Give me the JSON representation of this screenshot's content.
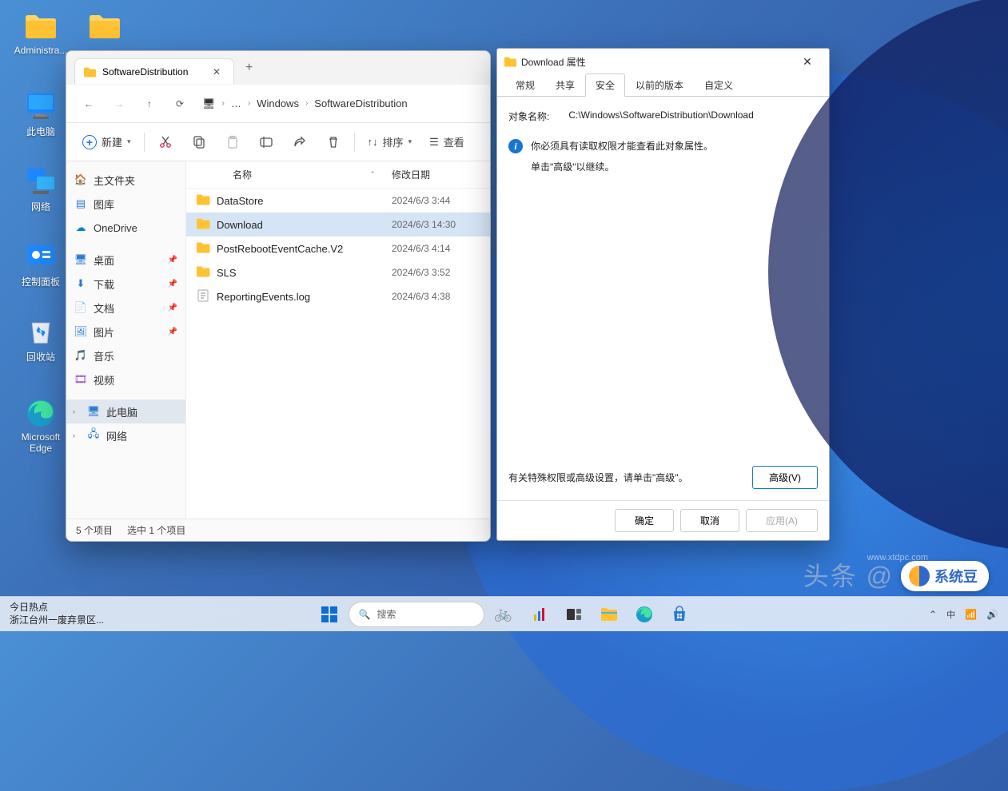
{
  "desktop_icons": {
    "administrator": "Administra...",
    "this_pc": "此电脑",
    "network": "网络",
    "control_panel": "控制面板",
    "recycle_bin": "回收站",
    "edge": "Microsoft Edge"
  },
  "explorer": {
    "tab_title": "SoftwareDistribution",
    "breadcrumb": {
      "ellipsis": "…",
      "seg1": "Windows",
      "seg2": "SoftwareDistribution"
    },
    "toolbar": {
      "new": "新建",
      "sort": "排序",
      "view": "查看"
    },
    "sidebar": {
      "home": "主文件夹",
      "gallery": "图库",
      "onedrive": "OneDrive",
      "desktop": "桌面",
      "downloads": "下载",
      "documents": "文档",
      "pictures": "图片",
      "music": "音乐",
      "videos": "视频",
      "this_pc": "此电脑",
      "network": "网络"
    },
    "columns": {
      "name": "名称",
      "modified": "修改日期"
    },
    "files": [
      {
        "name": "DataStore",
        "type": "folder",
        "date": "2024/6/3 3:44"
      },
      {
        "name": "Download",
        "type": "folder",
        "date": "2024/6/3 14:30",
        "selected": true
      },
      {
        "name": "PostRebootEventCache.V2",
        "type": "folder",
        "date": "2024/6/3 4:14"
      },
      {
        "name": "SLS",
        "type": "folder",
        "date": "2024/6/3 3:52"
      },
      {
        "name": "ReportingEvents.log",
        "type": "file",
        "date": "2024/6/3 4:38"
      }
    ],
    "status": {
      "count": "5 个项目",
      "selected": "选中 1 个项目"
    }
  },
  "dialog": {
    "title": "Download 属性",
    "tabs": {
      "general": "常规",
      "sharing": "共享",
      "security": "安全",
      "previous": "以前的版本",
      "customize": "自定义"
    },
    "object_label": "对象名称:",
    "object_path": "C:\\Windows\\SoftwareDistribution\\Download",
    "warning": "你必须具有读取权限才能查看此对象属性。",
    "advice": "单击\"高级\"以继续。",
    "advanced_hint": "有关特殊权限或高级设置，请单击\"高级\"。",
    "advanced_button": "高级(V)",
    "ok": "确定",
    "cancel": "取消",
    "apply": "应用(A)"
  },
  "taskbar": {
    "hot_label": "今日热点",
    "hot_text": "浙江台州一废弃景区...",
    "search_placeholder": "搜索"
  },
  "watermark": "头条 @ 九天…",
  "logo_text": "系统豆",
  "url": "www.xtdpc.com"
}
